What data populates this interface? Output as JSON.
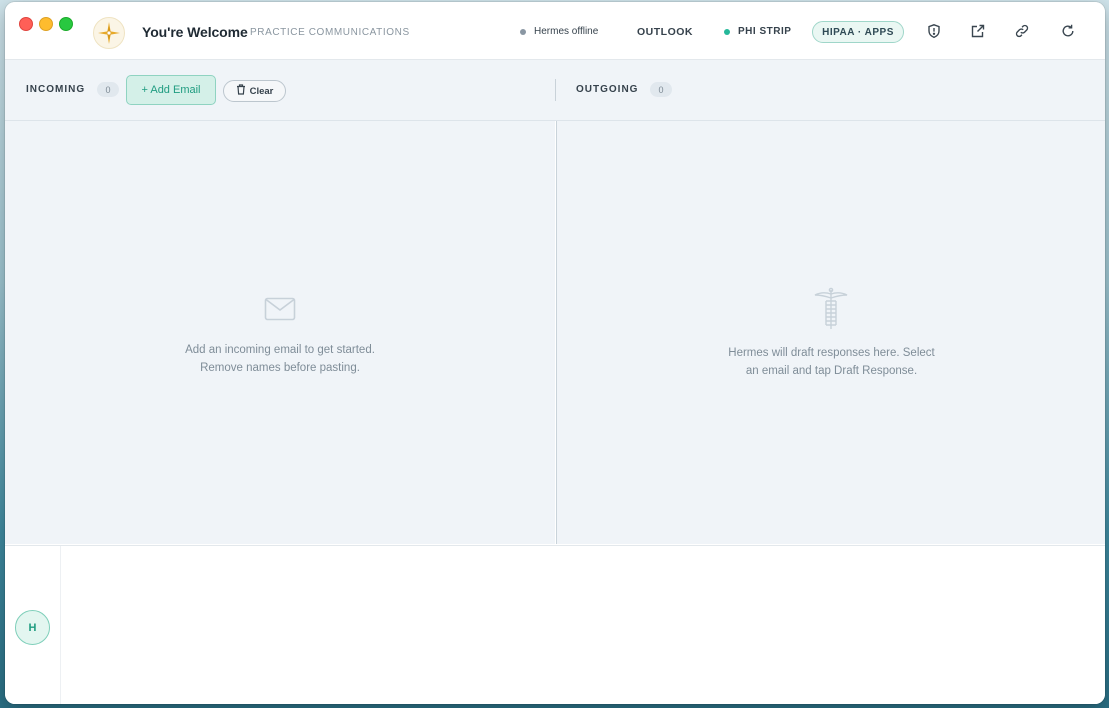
{
  "app": {
    "title": "You're Welcome",
    "subtitle": "PRACTICE COMMUNICATIONS",
    "logo_icon": "compass-star-icon"
  },
  "header": {
    "hermes_status": "Hermes offline",
    "hermes_status_color": "#8a97a3",
    "outlook_label": "OUTLOOK",
    "phi_strip_label": "PHI STRIP",
    "phi_strip_status_color": "#25b89a",
    "hipaa_label": "HIPAA · APPS",
    "icons": [
      "shield-icon",
      "external-link-icon",
      "link-icon",
      "refresh-icon"
    ]
  },
  "incoming": {
    "label": "INCOMING",
    "count": "0",
    "add_button": "+ Add Email",
    "clear_button": "Clear",
    "empty_icon": "envelope-icon",
    "empty_line1": "Add an incoming email to get started.",
    "empty_line2": "Remove names before pasting."
  },
  "outgoing": {
    "label": "OUTGOING",
    "count": "0",
    "empty_icon": "caduceus-icon",
    "empty_line1": "Hermes will draft responses here. Select",
    "empty_line2": "an email and tap Draft Response."
  },
  "footer": {
    "avatar_initial": "H"
  },
  "colors": {
    "accent": "#1f9c80",
    "panel_bg": "#f0f4f8"
  }
}
